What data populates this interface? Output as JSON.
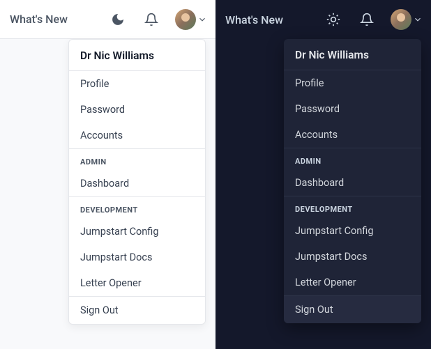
{
  "header": {
    "whats_new": "What's New"
  },
  "user": {
    "name": "Dr Nic Williams"
  },
  "menu": {
    "profile": "Profile",
    "password": "Password",
    "accounts": "Accounts",
    "section_admin": "ADMIN",
    "dashboard": "Dashboard",
    "section_dev": "DEVELOPMENT",
    "jumpstart_config": "Jumpstart Config",
    "jumpstart_docs": "Jumpstart Docs",
    "letter_opener": "Letter Opener",
    "sign_out": "Sign Out"
  }
}
